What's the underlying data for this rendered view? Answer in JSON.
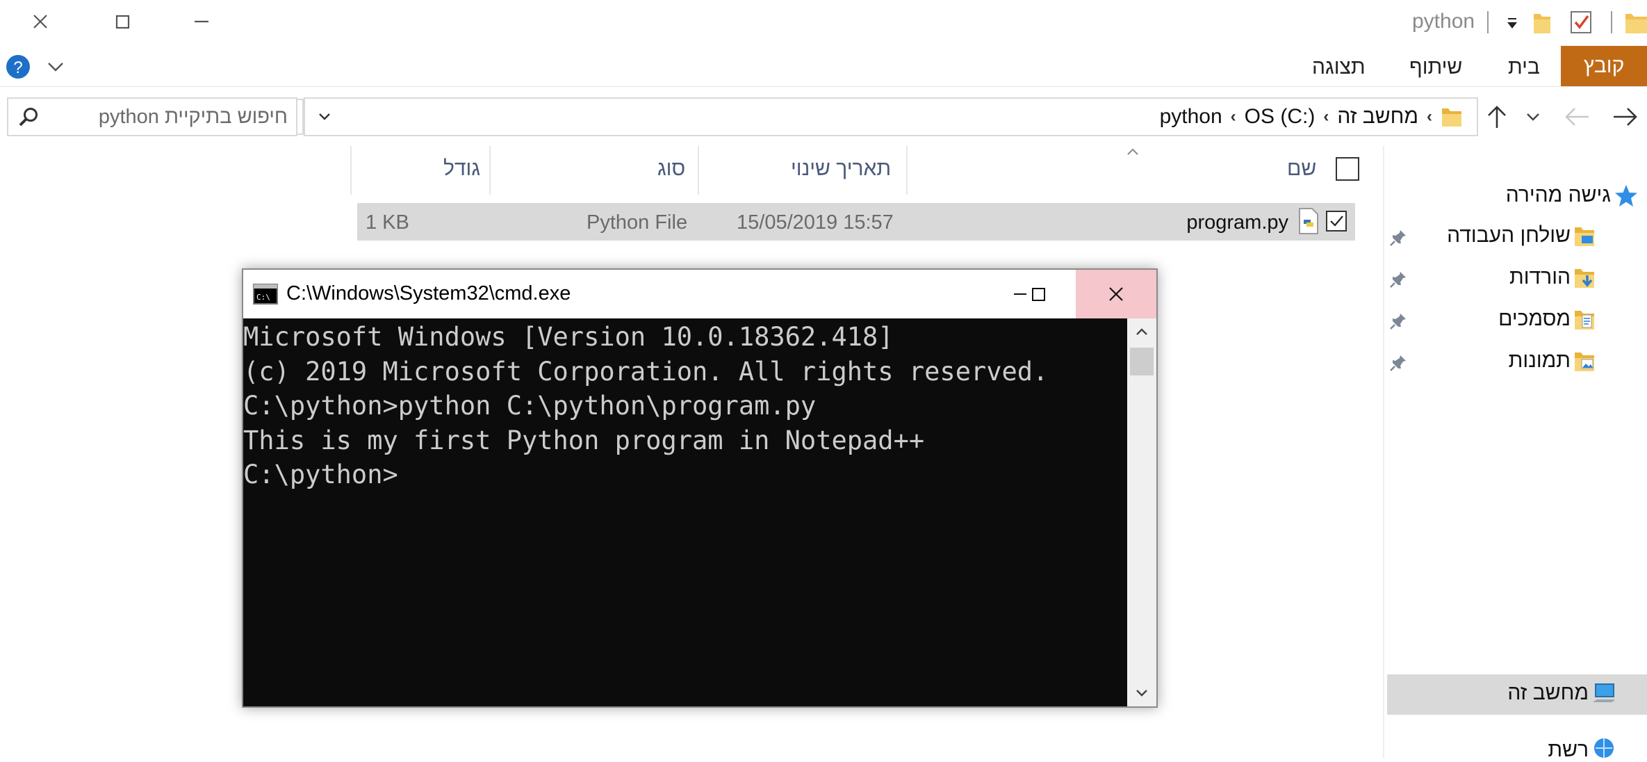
{
  "window": {
    "title": "python"
  },
  "ribbon": {
    "tab_file": "קובץ",
    "tab_home": "בית",
    "tab_share": "שיתוף",
    "tab_view": "תצוגה"
  },
  "address": {
    "crumbs": [
      "מחשב זה",
      "OS (C:)",
      "python"
    ]
  },
  "search": {
    "placeholder": "חיפוש בתיקיית python"
  },
  "columns": {
    "name": "שם",
    "date": "תאריך שינוי",
    "type": "סוג",
    "size": "גודל"
  },
  "files": [
    {
      "name": "program.py",
      "date": "15/05/2019 15:57",
      "type": "Python File",
      "size": "1 KB"
    }
  ],
  "nav": {
    "quick_access": "גישה מהירה",
    "items": [
      {
        "label": "שולחן העבודה",
        "icon": "desktop-folder-icon"
      },
      {
        "label": "הורדות",
        "icon": "downloads-folder-icon"
      },
      {
        "label": "מסמכים",
        "icon": "documents-folder-icon"
      },
      {
        "label": "תמונות",
        "icon": "pictures-folder-icon"
      }
    ],
    "this_pc": "מחשב זה",
    "network": "רשת"
  },
  "cmd": {
    "title": "C:\\Windows\\System32\\cmd.exe",
    "lines": [
      "Microsoft Windows [Version 10.0.18362.418]",
      "(c) 2019 Microsoft Corporation. All rights reserved.",
      "",
      "C:\\python>python C:\\python\\program.py",
      "This is my first Python program in Notepad++",
      "",
      "C:\\python>"
    ]
  },
  "colors": {
    "file_tab": "#c06a16",
    "selection": "#d9d9d9",
    "cmd_background": "#0c0c0c",
    "cmd_text": "#cccccc",
    "close_hover": "#f5c6cb",
    "help": "#1e6fc8"
  }
}
